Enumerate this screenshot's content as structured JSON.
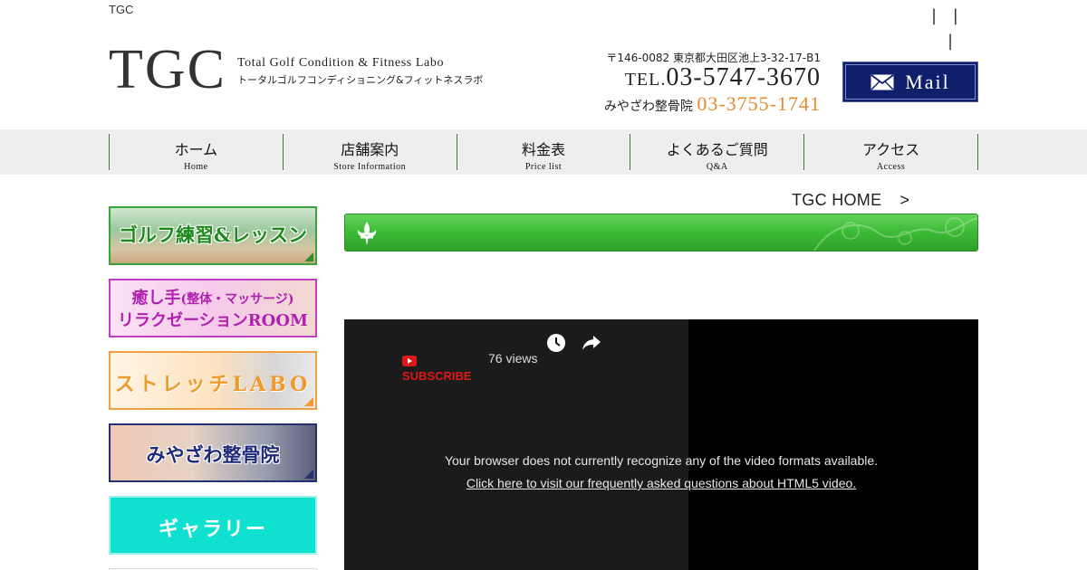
{
  "header": {
    "top_tag": "TGC",
    "top_bars_line1": "| |",
    "top_bars_line2": "|",
    "logo": "TGC",
    "logo_sub_en": "Total Golf Condition & Fitness Labo",
    "logo_sub_jp": "トータルゴルフコンディショニング&フィットネスラボ",
    "address": "〒146-0082 東京都大田区池上3-32-17-B1",
    "tel_prefix": "TEL.",
    "tel": "03-5747-3670",
    "tel2_label": "みやざわ整骨院",
    "tel2": "03-3755-1741",
    "mail_label": "Mail"
  },
  "nav": [
    {
      "jp": "ホーム",
      "en": "Home"
    },
    {
      "jp": "店舗案内",
      "en": "Store Information"
    },
    {
      "jp": "料金表",
      "en": "Price list"
    },
    {
      "jp": "よくあるご質問",
      "en": "Q&A"
    },
    {
      "jp": "アクセス",
      "en": "Access"
    }
  ],
  "sidebar": {
    "golf": "ゴルフ練習&レッスン",
    "relax_line1_a": "癒し手",
    "relax_line1_b": "(整体・マッサージ)",
    "relax_line2": "リラクゼーションROOM",
    "stretch": "ストレッチLABO",
    "seikotsu": "みやざわ整骨院",
    "gallery": "ギャラリー"
  },
  "breadcrumb": {
    "label": "TGC HOME",
    "arrow": ">"
  },
  "video": {
    "subscribe": "SUBSCRIBE",
    "views": "76 views",
    "message": "Your browser does not currently recognize any of the video formats available.",
    "faq_link": "Click here to visit our frequently asked questions about HTML5 video."
  },
  "colors": {
    "nav_divider": "#3d7a35",
    "mail_bg": "#0f1f6b",
    "tel2_accent": "#e8892c",
    "green_bar": "#3cba35",
    "gallery": "#0fe0cf",
    "subscribe_red": "#e01818"
  }
}
